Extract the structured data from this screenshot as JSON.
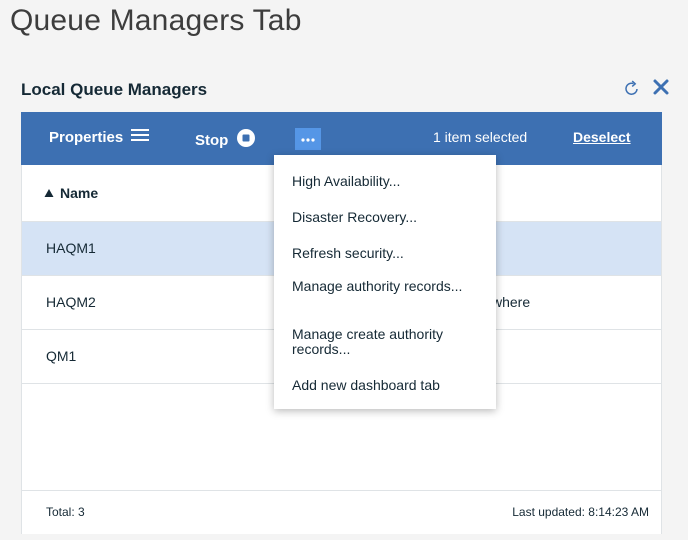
{
  "page": {
    "title": "Queue Managers Tab"
  },
  "widget": {
    "title": "Local Queue Managers",
    "refresh_icon": "refresh-icon",
    "close_icon": "close-icon"
  },
  "toolbar": {
    "properties_label": "Properties",
    "properties_icon": "list-icon",
    "stop_label": "Stop",
    "stop_icon": "stop-circle-icon",
    "more_icon": "overflow-menu-icon",
    "selection_text": "1 item selected",
    "deselect_label": "Deselect"
  },
  "table": {
    "columns": [
      {
        "label": "Name",
        "sort": "ascending"
      }
    ],
    "rows": [
      {
        "name": "HAQM1",
        "selected": true,
        "extra": ""
      },
      {
        "name": "HAQM2",
        "selected": false,
        "extra": "where"
      },
      {
        "name": "QM1",
        "selected": false,
        "extra": ""
      }
    ],
    "footer": {
      "total": "Total: 3",
      "last_updated": "Last updated: 8:14:23 AM"
    }
  },
  "menu": {
    "items": [
      {
        "label": "High Availability..."
      },
      {
        "label": "Disaster Recovery..."
      },
      {
        "label": "Refresh security..."
      },
      {
        "label": "Manage authority records..."
      },
      {
        "label": "Manage create authority records..."
      },
      {
        "label": "Add new dashboard tab"
      }
    ]
  },
  "colors": {
    "toolbar_bg": "#3d70b2",
    "selected_row_bg": "#d5e3f5",
    "overflow_button_bg": "#5596e6",
    "close_icon": "#3d70b2",
    "page_bg": "#f4f4f4"
  }
}
